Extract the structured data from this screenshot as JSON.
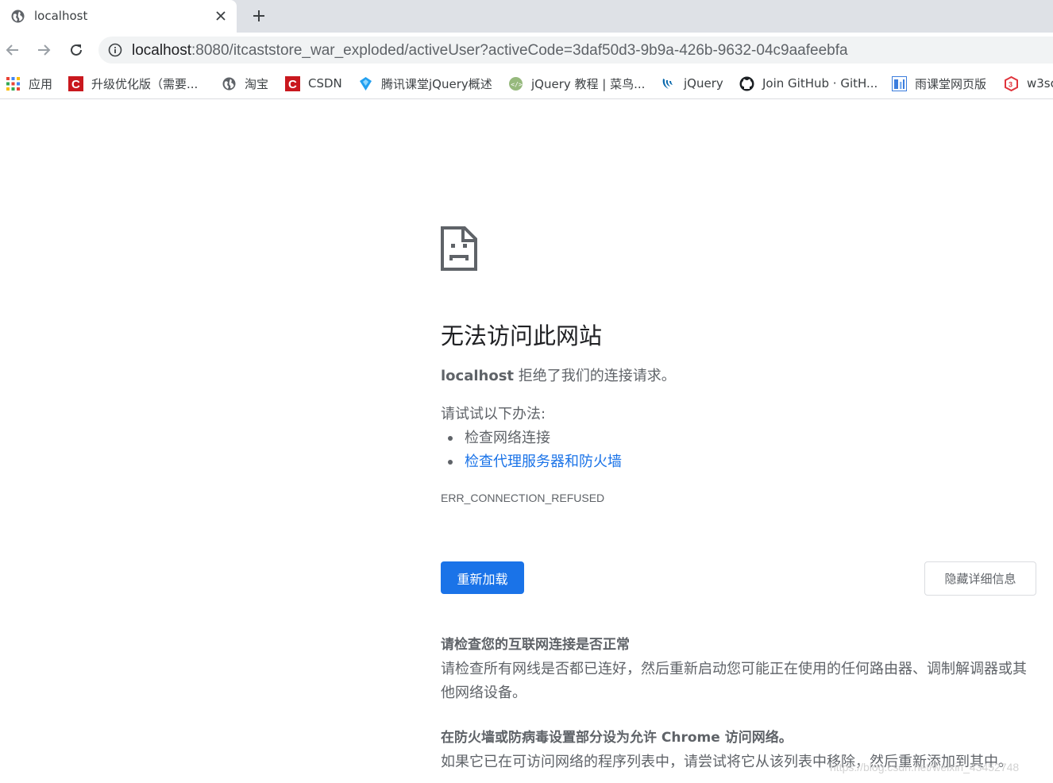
{
  "browser": {
    "tab": {
      "title": "localhost",
      "favicon": "globe-icon"
    },
    "url": {
      "host": "localhost",
      "rest": ":8080/itcaststore_war_exploded/activeUser?activeCode=3daf50d3-9b9a-426b-9632-04c9aafeebfa"
    },
    "bookmarks": [
      {
        "label": "应用",
        "icon": "apps-grid-icon"
      },
      {
        "label": "升级优化版（需要...",
        "icon": "csdn-icon"
      },
      {
        "label": "淘宝",
        "icon": "globe-icon"
      },
      {
        "label": "CSDN",
        "icon": "csdn-icon"
      },
      {
        "label": "腾讯课堂jQuery概述",
        "icon": "tencent-classroom-icon"
      },
      {
        "label": "jQuery 教程 | 菜鸟...",
        "icon": "runoob-icon"
      },
      {
        "label": "jQuery",
        "icon": "jquery-icon"
      },
      {
        "label": "Join GitHub · GitH...",
        "icon": "github-icon"
      },
      {
        "label": "雨课堂网页版",
        "icon": "rain-classroom-icon"
      },
      {
        "label": "w3sc",
        "icon": "w3school-icon"
      }
    ]
  },
  "error": {
    "title": "无法访问此网站",
    "summary_host": "localhost",
    "summary_text": " 拒绝了我们的连接请求。",
    "try_label": "请试试以下办法:",
    "suggestions": [
      "检查网络连接",
      "检查代理服务器和防火墙"
    ],
    "code": "ERR_CONNECTION_REFUSED",
    "reload_label": "重新加载",
    "details_label": "隐藏详细信息",
    "details": [
      {
        "heading": "请检查您的互联网连接是否正常",
        "text": "请检查所有网线是否都已连好，然后重新启动您可能正在使用的任何路由器、调制解调器或其他网络设备。"
      },
      {
        "heading": "在防火墙或防病毒设置部分设为允许 Chrome 访问网络。",
        "text": "如果它已在可访问网络的程序列表中，请尝试将它从该列表中移除，然后重新添加到其中。"
      }
    ]
  },
  "watermark": "https://blog.csdn.net/weixin_43452748",
  "colors": {
    "link": "#1a73e8",
    "button": "#1a73e8",
    "tabstrip": "#dee1e6",
    "text_secondary": "#5f6368"
  }
}
